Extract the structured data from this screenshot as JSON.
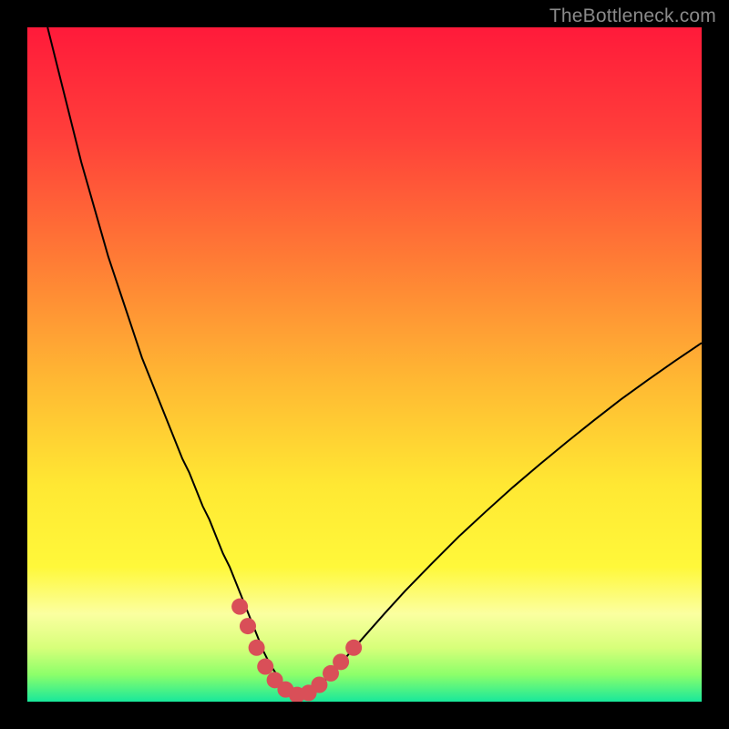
{
  "watermark": {
    "text": "TheBottleneck.com"
  },
  "plot": {
    "gradient_stops": [
      {
        "pct": 0,
        "color": "#ff1a3a"
      },
      {
        "pct": 16,
        "color": "#ff3f3a"
      },
      {
        "pct": 34,
        "color": "#ff7a35"
      },
      {
        "pct": 52,
        "color": "#ffb733"
      },
      {
        "pct": 68,
        "color": "#ffe833"
      },
      {
        "pct": 80,
        "color": "#fff83a"
      },
      {
        "pct": 87,
        "color": "#fbffa0"
      },
      {
        "pct": 92,
        "color": "#d7ff7a"
      },
      {
        "pct": 96,
        "color": "#8cff6a"
      },
      {
        "pct": 100,
        "color": "#18e89b"
      }
    ],
    "curve_color": "#000000",
    "curve_width": 2,
    "marker_color": "#d94f58",
    "marker_radius": 9
  },
  "chart_data": {
    "type": "line",
    "title": "",
    "xlabel": "",
    "ylabel": "",
    "xlim": [
      0,
      100
    ],
    "ylim": [
      0,
      100
    ],
    "grid": false,
    "legend": false,
    "x": [
      3,
      4,
      5,
      6,
      7,
      8,
      9,
      10,
      11,
      12,
      13,
      14,
      15,
      16,
      17,
      18,
      19,
      20,
      21,
      22,
      23,
      24,
      25,
      26,
      27,
      28,
      29,
      30,
      31,
      32,
      33,
      34,
      35,
      36,
      37,
      38,
      39,
      40,
      41,
      42,
      43,
      45,
      47,
      50,
      53,
      56,
      60,
      64,
      68,
      72,
      76,
      80,
      84,
      88,
      92,
      96,
      100
    ],
    "y": [
      100,
      96,
      92,
      88,
      84,
      80,
      76.5,
      73,
      69.5,
      66,
      63,
      60,
      57,
      54,
      51,
      48.5,
      46,
      43.5,
      41,
      38.5,
      36,
      34,
      31.5,
      29,
      27,
      24.5,
      22,
      20,
      17.5,
      15,
      12.5,
      10,
      7.5,
      5.5,
      4,
      2.5,
      1.5,
      1,
      1,
      1.2,
      2,
      4,
      6.3,
      9.7,
      13.1,
      16.4,
      20.5,
      24.5,
      28.2,
      31.8,
      35.2,
      38.5,
      41.7,
      44.8,
      47.7,
      50.5,
      53.2
    ],
    "markers": [
      {
        "x": 31.5,
        "y": 14.1
      },
      {
        "x": 32.7,
        "y": 11.2
      },
      {
        "x": 34.0,
        "y": 8.0
      },
      {
        "x": 35.3,
        "y": 5.2
      },
      {
        "x": 36.7,
        "y": 3.2
      },
      {
        "x": 38.3,
        "y": 1.8
      },
      {
        "x": 40.0,
        "y": 1.0
      },
      {
        "x": 41.7,
        "y": 1.3
      },
      {
        "x": 43.3,
        "y": 2.5
      },
      {
        "x": 45.0,
        "y": 4.2
      },
      {
        "x": 46.5,
        "y": 5.9
      },
      {
        "x": 48.4,
        "y": 8.0
      }
    ]
  }
}
